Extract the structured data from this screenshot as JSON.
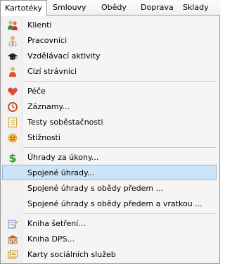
{
  "menubar": {
    "items": [
      {
        "label": "Kartotéky",
        "active": true
      },
      {
        "label": "Smlouvy"
      },
      {
        "label": "Obědy"
      },
      {
        "label": "Doprava"
      },
      {
        "label": "Sklady"
      }
    ]
  },
  "menu": {
    "items": [
      {
        "label": "Klienti",
        "icon": "clients-icon"
      },
      {
        "label": "Pracovníci",
        "icon": "worker-icon"
      },
      {
        "label": "Vzdělávací aktivity",
        "icon": "graduation-cap-icon"
      },
      {
        "label": "Cizí strávníci",
        "icon": "person-icon"
      },
      {
        "label": "Péče",
        "icon": "heart-icon"
      },
      {
        "label": "Záznamy...",
        "icon": "clock-icon"
      },
      {
        "label": "Testy soběstačnosti",
        "icon": "checklist-icon"
      },
      {
        "label": "Stížnosti",
        "icon": "complaint-icon"
      },
      {
        "label": "Úhrady za úkony...",
        "icon": "dollar-icon"
      },
      {
        "label": "Spojené úhrady...",
        "icon": "",
        "highlighted": true
      },
      {
        "label": "Spojené úhrady s obědy předem ...",
        "icon": ""
      },
      {
        "label": "Spojené úhrady s obědy předem a vratkou ...",
        "icon": ""
      },
      {
        "label": "Kniha šetření...",
        "icon": "notebook-pencil-icon"
      },
      {
        "label": "Kniha DPS...",
        "icon": "building-icon"
      },
      {
        "label": "Karty sociálních služeb",
        "icon": "cards-icon"
      }
    ]
  }
}
